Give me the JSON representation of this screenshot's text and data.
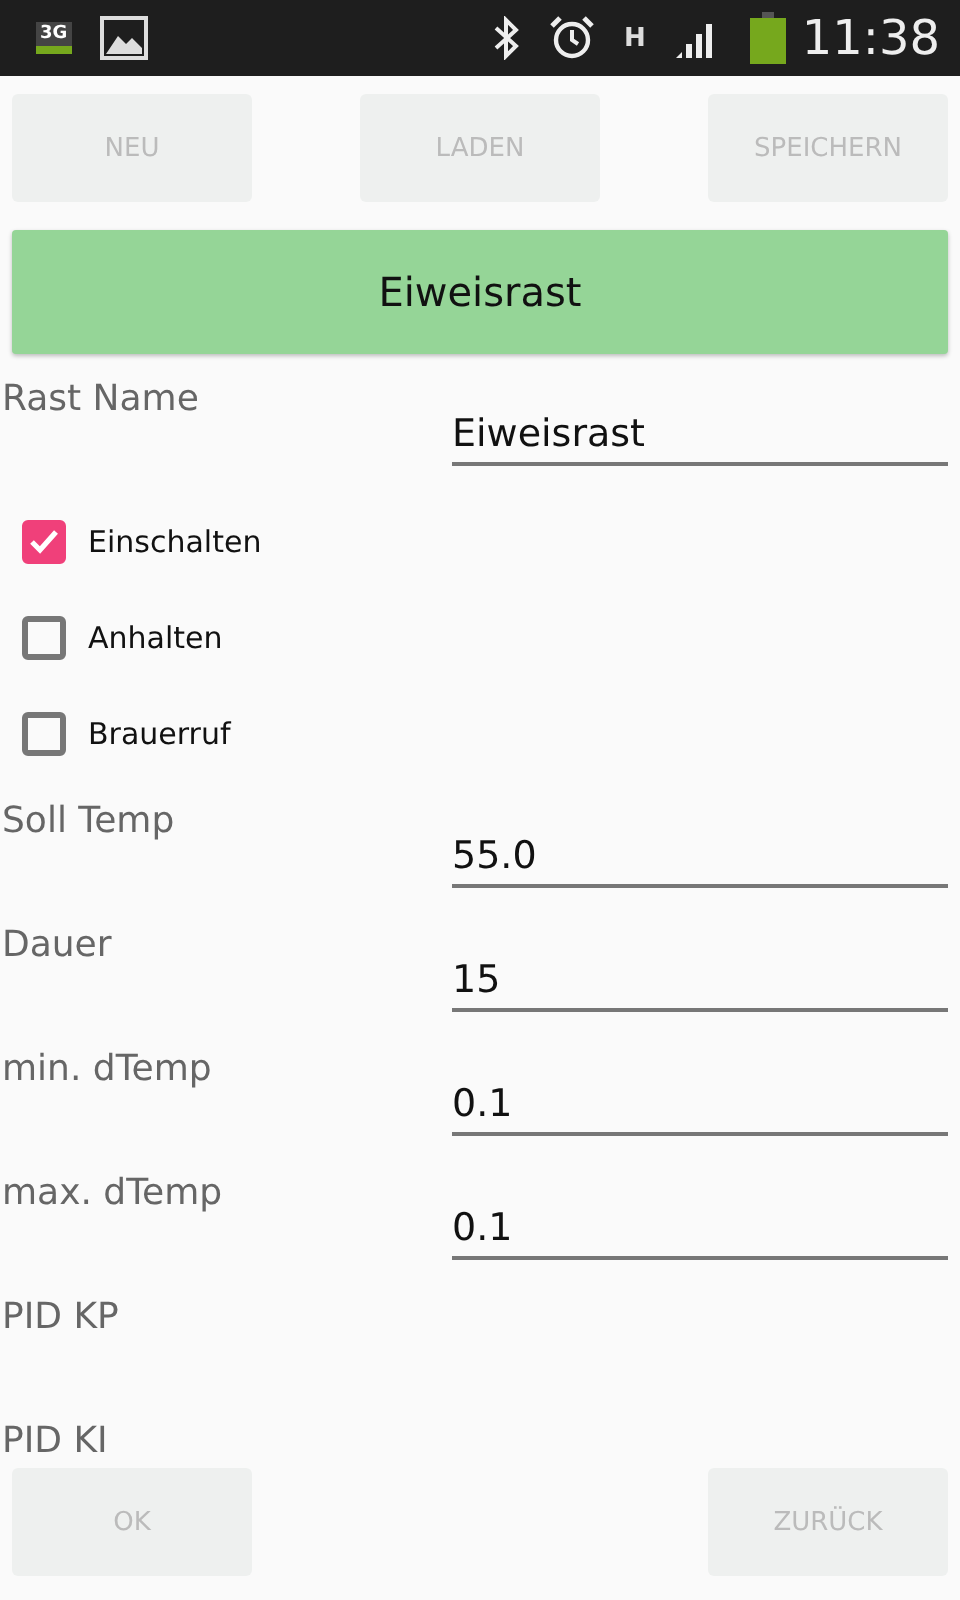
{
  "status_bar": {
    "time": "11:38",
    "network": "3G",
    "data": "H"
  },
  "top_buttons": [
    {
      "label": "NEU",
      "disabled": true
    },
    {
      "label": "LADEN",
      "disabled": true
    },
    {
      "label": "SPEICHERN",
      "disabled": true
    }
  ],
  "header_button": {
    "label": "Eiweisrast"
  },
  "name_row": {
    "label": "Rast Name",
    "value": "Eiweisrast"
  },
  "checkboxes": [
    {
      "label": "Einschalten",
      "checked": true
    },
    {
      "label": "Anhalten",
      "checked": false
    },
    {
      "label": "Brauerruf",
      "checked": false
    }
  ],
  "rows": [
    {
      "kind": "field",
      "label": "Soll Temp",
      "value": "55.0"
    },
    {
      "kind": "field",
      "label": "Dauer",
      "value": "15"
    },
    {
      "kind": "field",
      "label": "min. dTemp",
      "value": "0.1"
    },
    {
      "kind": "field",
      "label": "max. dTemp",
      "value": "0.1"
    },
    {
      "kind": "label",
      "label": "PID KP"
    },
    {
      "kind": "label",
      "label": "PID KI"
    }
  ],
  "bottom_buttons": [
    {
      "label": "OK",
      "disabled": true
    },
    {
      "label": "ZURÜCK",
      "disabled": true
    }
  ]
}
